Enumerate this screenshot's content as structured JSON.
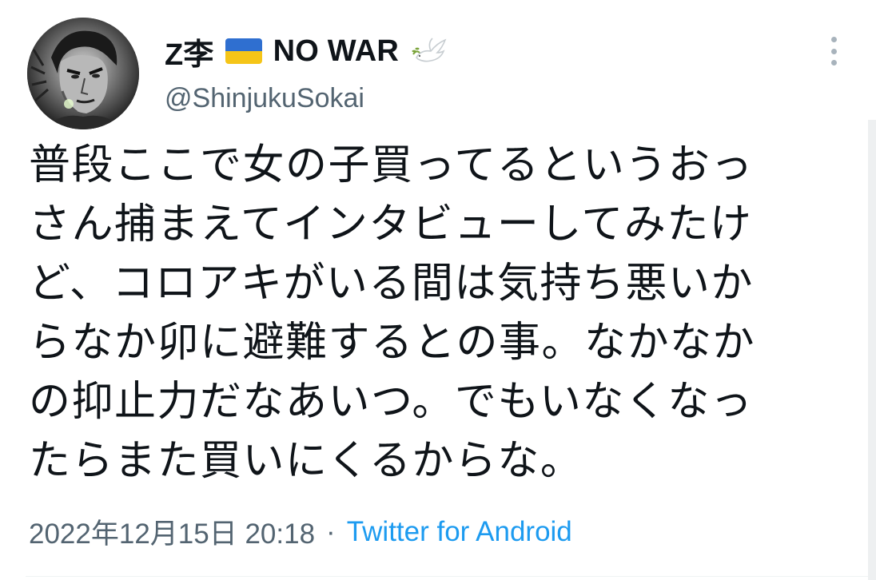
{
  "tweet": {
    "author": {
      "display_name": "Z李",
      "name_suffix": "NO WAR",
      "handle": "@ShinjukuSokai",
      "flag_icon": "ukraine-flag-icon",
      "dove_icon": "dove-with-olive-branch-icon"
    },
    "text_lines": [
      "普段ここで女の子買ってるというおっ",
      "さん捕まえてインタビューしてみたけ",
      "ど、コロアキがいる間は気持ち悪いか",
      "らなか卯に避難するとの事。なかなか",
      "の抑止力だなあいつ。でもいなくなっ",
      "たらまた買いにくるからな。"
    ],
    "meta": {
      "timestamp": "2022年12月15日 20:18",
      "separator": "·",
      "source": "Twitter for Android"
    }
  },
  "colors": {
    "text_primary": "#0f1419",
    "text_secondary": "#536471",
    "link": "#1d9bf0",
    "flag_blue": "#2f6fd0",
    "flag_yellow": "#f5c518"
  }
}
